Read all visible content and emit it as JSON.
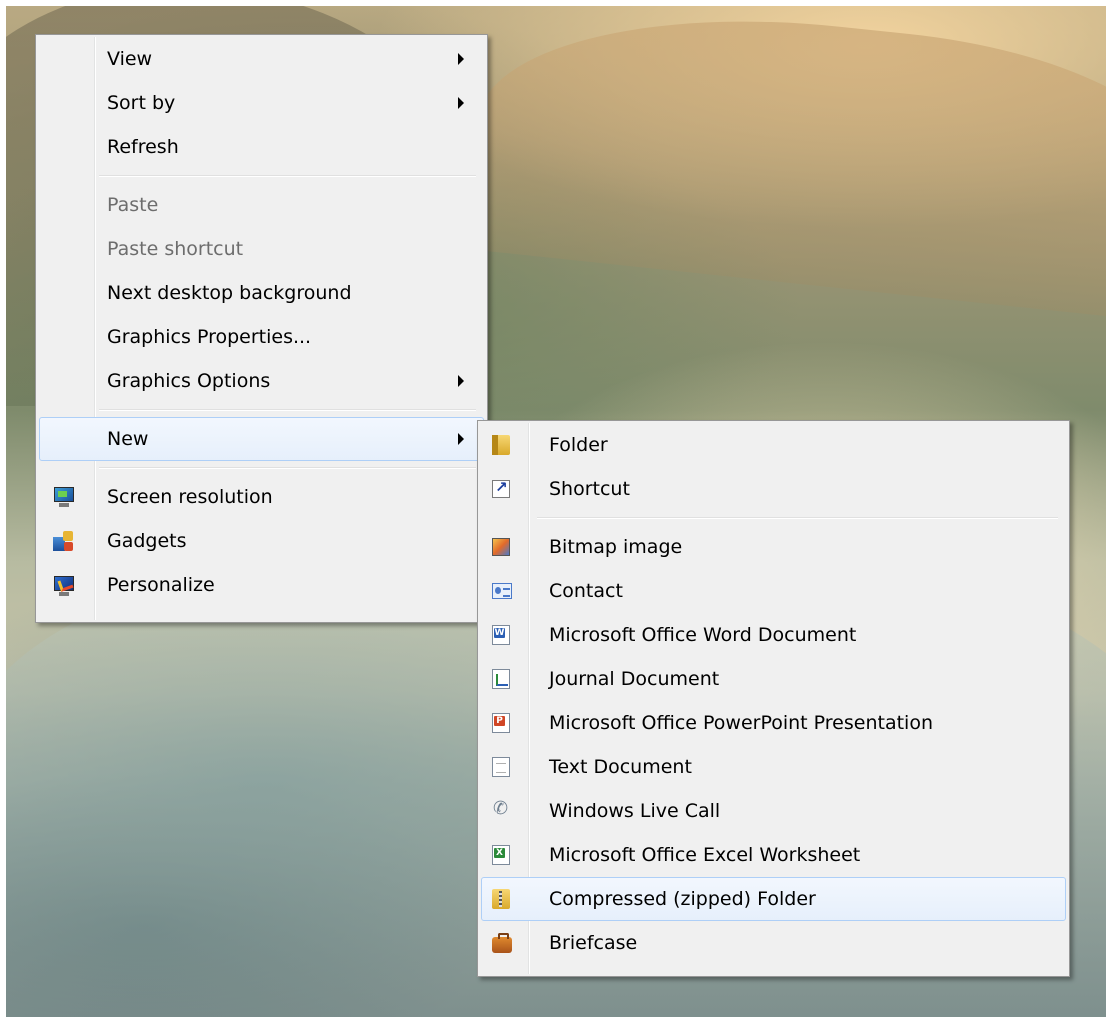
{
  "context_menu": {
    "items": [
      {
        "label": "View",
        "submenu": true,
        "disabled": false
      },
      {
        "label": "Sort by",
        "submenu": true,
        "disabled": false
      },
      {
        "label": "Refresh",
        "submenu": false,
        "disabled": false
      },
      {
        "label": "Paste",
        "submenu": false,
        "disabled": true
      },
      {
        "label": "Paste shortcut",
        "submenu": false,
        "disabled": true
      },
      {
        "label": "Next desktop background",
        "submenu": false,
        "disabled": false
      },
      {
        "label": "Graphics Properties...",
        "submenu": false,
        "disabled": false
      },
      {
        "label": "Graphics Options",
        "submenu": true,
        "disabled": false
      },
      {
        "label": "New",
        "submenu": true,
        "highlighted": true
      },
      {
        "label": "Screen resolution",
        "icon": "screen-resolution-icon"
      },
      {
        "label": "Gadgets",
        "icon": "gadgets-icon"
      },
      {
        "label": "Personalize",
        "icon": "personalize-icon"
      }
    ]
  },
  "new_submenu": {
    "items": [
      {
        "label": "Folder",
        "icon": "folder-icon"
      },
      {
        "label": "Shortcut",
        "icon": "shortcut-icon"
      },
      {
        "label": "Bitmap image",
        "icon": "bitmap-image-icon"
      },
      {
        "label": "Contact",
        "icon": "contact-card-icon"
      },
      {
        "label": "Microsoft Office Word Document",
        "icon": "word-document-icon"
      },
      {
        "label": "Journal Document",
        "icon": "journal-document-icon"
      },
      {
        "label": "Microsoft Office PowerPoint Presentation",
        "icon": "powerpoint-presentation-icon"
      },
      {
        "label": "Text Document",
        "icon": "text-document-icon"
      },
      {
        "label": "Windows Live Call",
        "icon": "phone-call-icon"
      },
      {
        "label": "Microsoft Office Excel Worksheet",
        "icon": "excel-worksheet-icon"
      },
      {
        "label": "Compressed (zipped) Folder",
        "icon": "zip-folder-icon",
        "highlighted": true
      },
      {
        "label": "Briefcase",
        "icon": "briefcase-icon"
      }
    ]
  },
  "colors": {
    "menu_background": "#f0f0f0",
    "highlight_border": "#aecff7",
    "disabled_text": "#6d6d6d"
  }
}
